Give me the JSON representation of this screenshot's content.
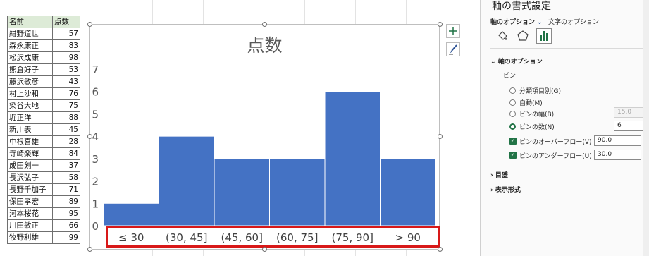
{
  "sheet": {
    "header": {
      "name": "名前",
      "score": "点数"
    },
    "rows": [
      {
        "name": "紺野道世",
        "score": "57"
      },
      {
        "name": "森永康正",
        "score": "83"
      },
      {
        "name": "松沢成康",
        "score": "98"
      },
      {
        "name": "熊倉好子",
        "score": "53"
      },
      {
        "name": "藤沢敏彦",
        "score": "43"
      },
      {
        "name": "村上沙和",
        "score": "76"
      },
      {
        "name": "染谷大地",
        "score": "75"
      },
      {
        "name": "堀正洋",
        "score": "88"
      },
      {
        "name": "新川表",
        "score": "45"
      },
      {
        "name": "中根喜雄",
        "score": "28"
      },
      {
        "name": "寺崎楽輝",
        "score": "84"
      },
      {
        "name": "成田剣一",
        "score": "37"
      },
      {
        "name": "長沢弘子",
        "score": "58"
      },
      {
        "name": "長野千加子",
        "score": "71"
      },
      {
        "name": "保田孝宏",
        "score": "89"
      },
      {
        "name": "河本桜花",
        "score": "95"
      },
      {
        "name": "川田敏正",
        "score": "66"
      },
      {
        "name": "牧野利雄",
        "score": "99"
      }
    ]
  },
  "chart_data": {
    "type": "bar",
    "title": "点数",
    "categories": [
      "≤ 30",
      "(30, 45]",
      "(45, 60]",
      "(60, 75]",
      "(75, 90]",
      "> 90"
    ],
    "values": [
      1,
      4,
      3,
      3,
      6,
      3
    ],
    "ylim": [
      0,
      7
    ],
    "yticks": [
      "0",
      "1",
      "2",
      "3",
      "4",
      "5",
      "6",
      "7"
    ],
    "bar_color": "#4472c4",
    "grid": false,
    "selected_element": "horizontal-axis"
  },
  "chart_buttons": {
    "add_icon": "plus-icon",
    "style_icon": "brush-icon"
  },
  "pane": {
    "title": "軸の書式設定",
    "tabs": {
      "axis_options": "軸のオプション",
      "text_options": "文字のオプション"
    },
    "icons": [
      "paint-bucket-icon",
      "pentagon-icon",
      "bar-chart-icon"
    ],
    "section_axis": "軸のオプション",
    "bin_label": "ビン",
    "options": {
      "by_category": "分類項目別(G)",
      "auto": "自動(M)",
      "bin_width": "ビンの幅(B)",
      "bin_count": "ビンの数(N)",
      "overflow": "ビンのオーバーフロー(V)",
      "underflow": "ビンのアンダーフロー(U)"
    },
    "values": {
      "bin_width": "15.0",
      "bin_count": "6",
      "overflow": "90.0",
      "underflow": "30.0"
    },
    "section_ticks": "目盛",
    "section_number": "表示形式",
    "accent": "#217346"
  }
}
